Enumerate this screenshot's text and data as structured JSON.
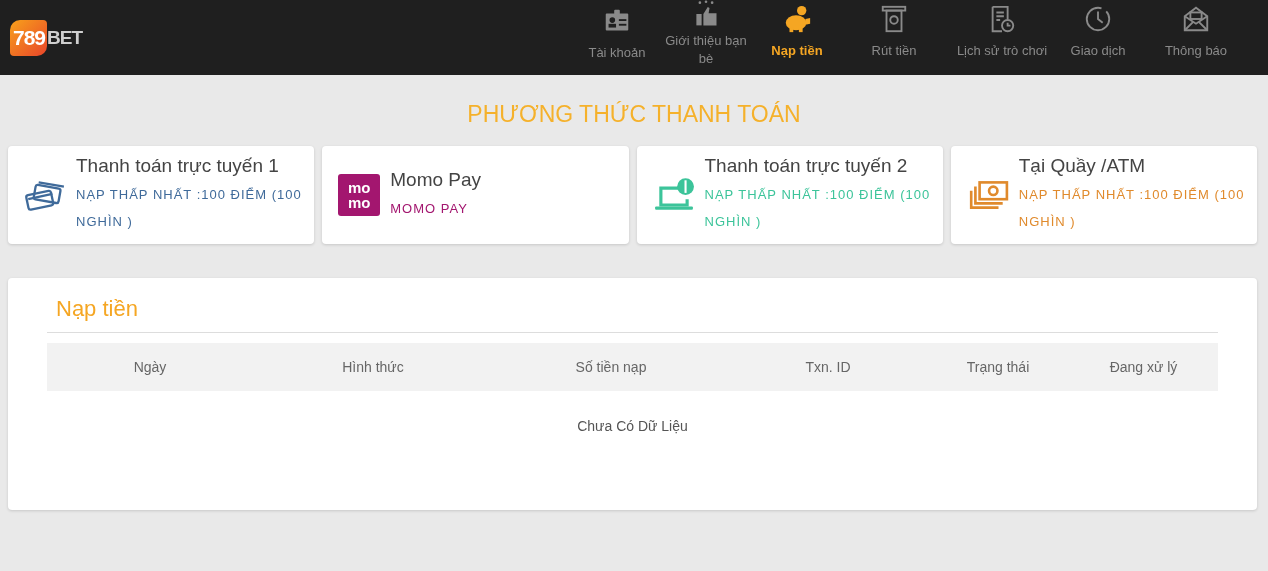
{
  "logo": {
    "number": "789",
    "word": "BET"
  },
  "nav": [
    {
      "kind": "id-card",
      "label": "Tài khoản",
      "selected": false
    },
    {
      "kind": "thumbs-up",
      "label": "Giới thiệu bạn bè",
      "selected": false
    },
    {
      "kind": "piggy",
      "label": "Nạp tiền",
      "selected": true
    },
    {
      "kind": "atm",
      "label": "Rút tiền",
      "selected": false
    },
    {
      "kind": "document",
      "label": "Lịch sử trò chơi",
      "selected": false
    },
    {
      "kind": "clock",
      "label": "Giao dịch",
      "selected": false
    },
    {
      "kind": "mail",
      "label": "Thông báo",
      "selected": false
    }
  ],
  "heading": "PHƯƠNG THỨC THANH TOÁN",
  "methods": [
    {
      "kind": "cards",
      "title": "Thanh toán trực tuyến 1",
      "note": "NẠP THẤP NHẤT :100 ĐIỂM (100 NGHÌN )",
      "color": "#3f6a9a"
    },
    {
      "kind": "momo",
      "title": "Momo Pay",
      "note": "MOMO PAY",
      "color": "#a3166f",
      "icon_text": [
        "mo",
        "mo"
      ]
    },
    {
      "kind": "laptop",
      "title": "Thanh toán trực tuyến 2",
      "note": "NẠP THẤP NHẤT :100 ĐIỂM (100 NGHÌN )",
      "color": "#3cc49a"
    },
    {
      "kind": "cash",
      "title": "Tại Quầy /ATM",
      "note": "NẠP THẤP NHẤT :100 ĐIỂM (100 NGHÌN )",
      "color": "#e08a2c"
    }
  ],
  "panel": {
    "title": "Nạp tiền",
    "table": {
      "columns": [
        "Ngày",
        "Hình thức",
        "Số tiền nạp",
        "Txn. ID",
        "Trạng thái",
        "Đang xử lý"
      ],
      "empty": "Chưa Có Dữ Liệu"
    }
  }
}
